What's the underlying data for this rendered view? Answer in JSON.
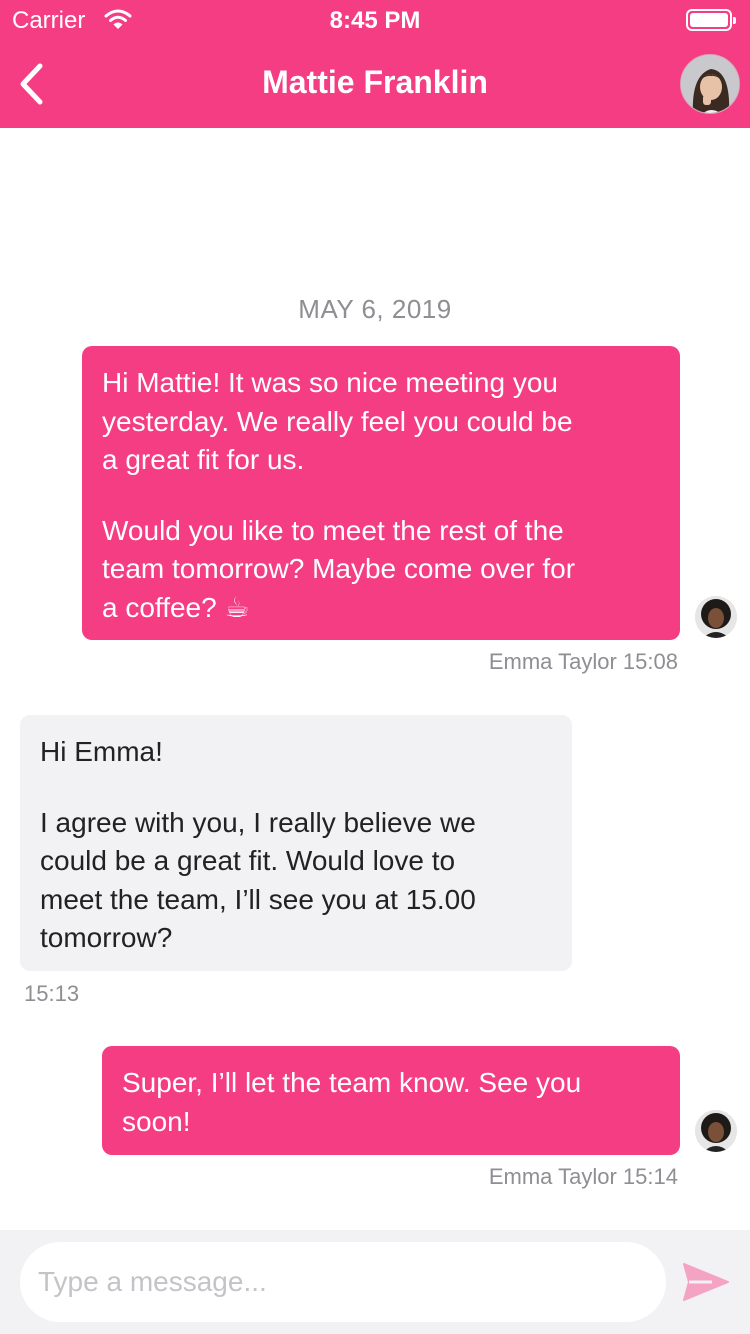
{
  "status_bar": {
    "carrier": "Carrier",
    "time": "8:45 PM"
  },
  "nav": {
    "title": "Mattie Franklin",
    "back_icon": "chevron-left-icon",
    "avatar_icon": "contact-avatar"
  },
  "conversation": {
    "date": "MAY 6, 2019",
    "messages": [
      {
        "direction": "outgoing",
        "lines": [
          "Hi Mattie! It was so nice meeting you",
          "yesterday. We really feel you could be",
          "a great fit for us.",
          "Would you like to meet the rest of the",
          "team tomorrow? Maybe come over for",
          "a coffee? ☕"
        ],
        "meta": "Emma Taylor 15:08"
      },
      {
        "direction": "incoming",
        "lines": [
          "Hi Emma!",
          "I agree with you, I really believe we",
          "could be a great fit. Would love to",
          "meet the team, I’ll see you at 15.00",
          "tomorrow?"
        ],
        "meta": "15:13"
      },
      {
        "direction": "outgoing",
        "lines": [
          "Super, I’ll let the team know. See you",
          "soon!"
        ],
        "meta": "Emma Taylor 15:14"
      }
    ]
  },
  "composer": {
    "placeholder": "Type a message...",
    "value": "",
    "send_icon": "send-icon"
  },
  "colors": {
    "accent": "#f53d84",
    "incoming_bubble": "#f2f2f4",
    "meta_text": "#8e8e93",
    "send_icon": "#f4a3c2"
  }
}
